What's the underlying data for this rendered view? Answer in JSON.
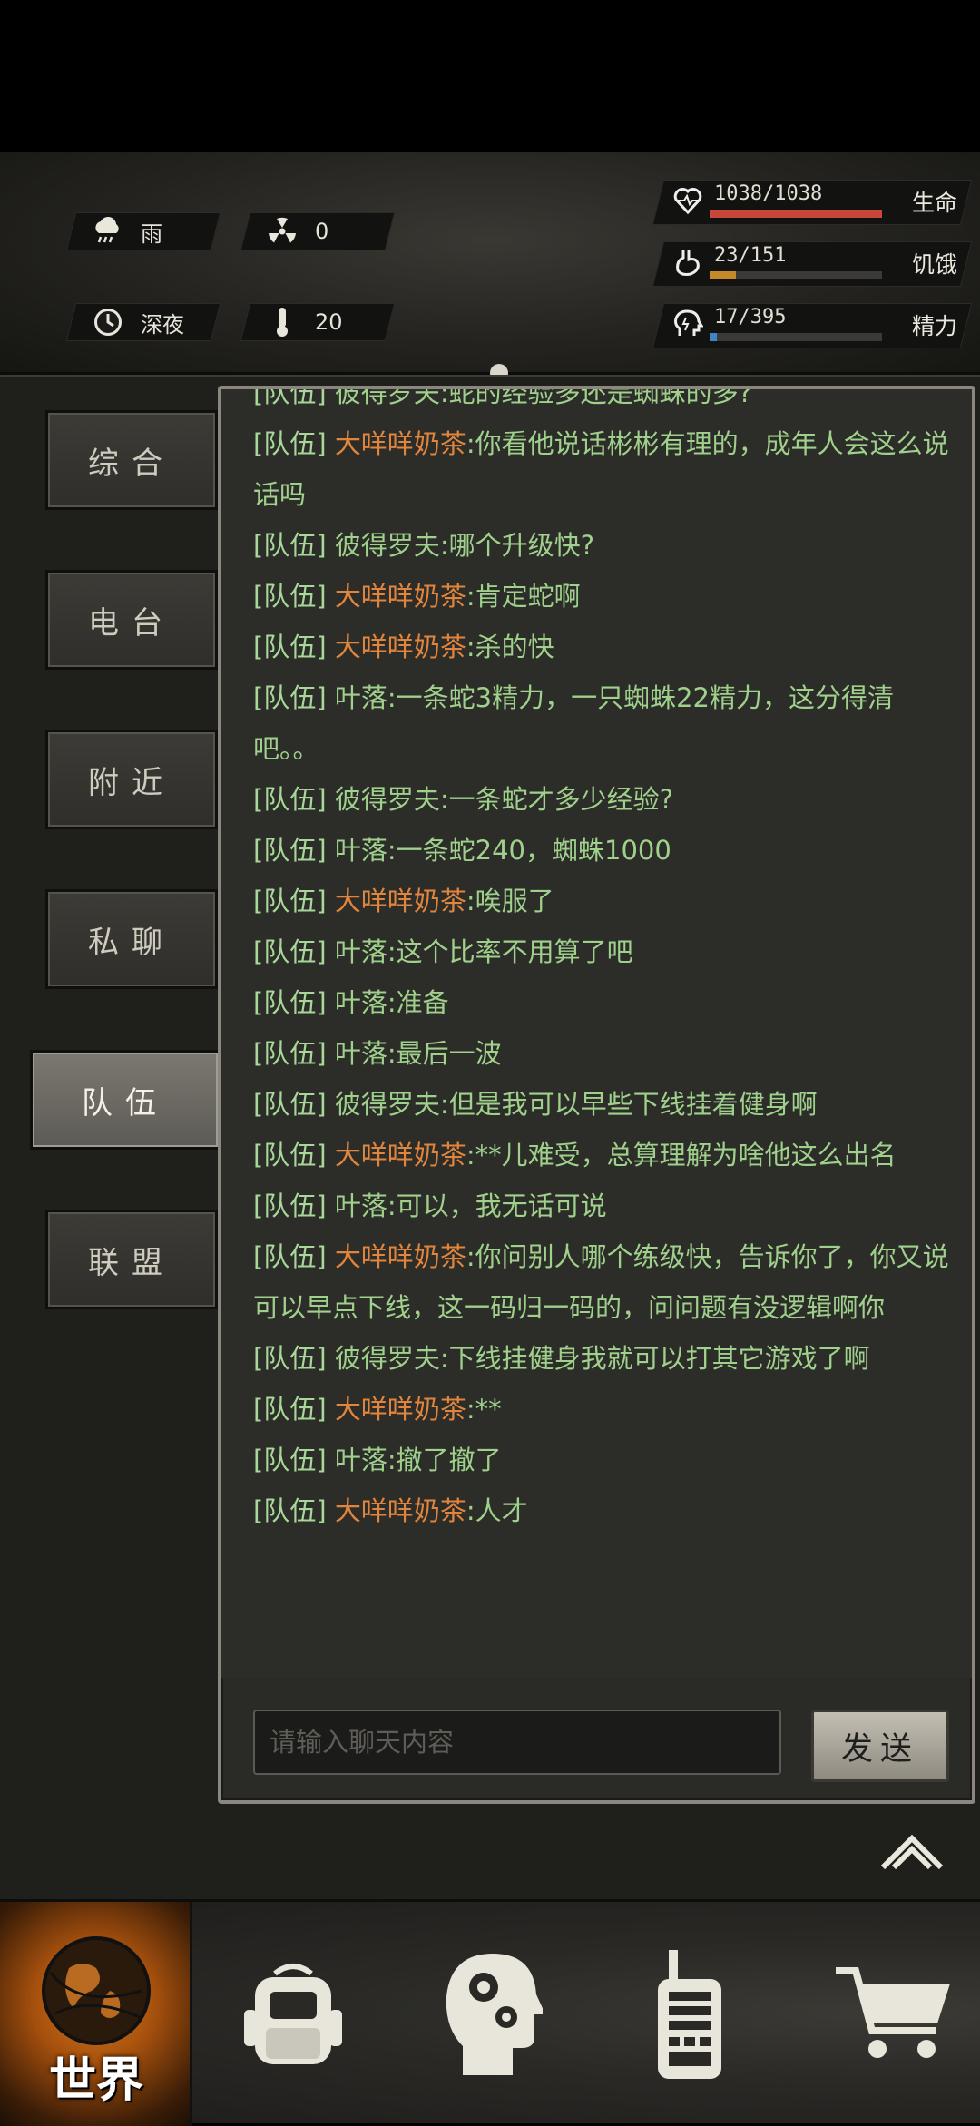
{
  "status": {
    "weather": {
      "icon": "rain-cloud-icon",
      "label": "雨"
    },
    "radiation": {
      "icon": "radiation-icon",
      "value": "0"
    },
    "time": {
      "icon": "clock-icon",
      "label": "深夜"
    },
    "temperature": {
      "icon": "thermometer-icon",
      "value": "20"
    },
    "vitals": [
      {
        "label": "生命",
        "text": "1038/1038",
        "fraction": 1.0,
        "color": "#c8463a",
        "icon": "heart-icon"
      },
      {
        "label": "饥饿",
        "text": "23/151",
        "fraction": 0.152,
        "color": "#c48a2a",
        "icon": "stomach-icon"
      },
      {
        "label": "精力",
        "text": "17/395",
        "fraction": 0.043,
        "color": "#3f86c8",
        "icon": "brain-icon"
      }
    ]
  },
  "tabs": [
    "综合",
    "电台",
    "附近",
    "私聊",
    "队伍",
    "联盟"
  ],
  "active_tab": "队伍",
  "chat": {
    "messages": [
      {
        "channel": "[队伍]",
        "name": "彼得罗夫",
        "orange": false,
        "text": "蛇的经验多还是蜘蛛的多?"
      },
      {
        "channel": "[队伍]",
        "name": "大咩咩奶茶",
        "orange": true,
        "text": "你看他说话彬彬有理的，成年人会这么说话吗"
      },
      {
        "channel": "[队伍]",
        "name": "彼得罗夫",
        "orange": false,
        "text": "哪个升级快?"
      },
      {
        "channel": "[队伍]",
        "name": "大咩咩奶茶",
        "orange": true,
        "text": "肯定蛇啊"
      },
      {
        "channel": "[队伍]",
        "name": "大咩咩奶茶",
        "orange": true,
        "text": "杀的快"
      },
      {
        "channel": "[队伍]",
        "name": "叶落",
        "orange": false,
        "text": "一条蛇3精力，一只蜘蛛22精力，这分得清吧。。"
      },
      {
        "channel": "[队伍]",
        "name": "彼得罗夫",
        "orange": false,
        "text": "一条蛇才多少经验?"
      },
      {
        "channel": "[队伍]",
        "name": "叶落",
        "orange": false,
        "text": "一条蛇240，蜘蛛1000"
      },
      {
        "channel": "[队伍]",
        "name": "大咩咩奶茶",
        "orange": true,
        "text": "唉服了"
      },
      {
        "channel": "[队伍]",
        "name": "叶落",
        "orange": false,
        "text": "这个比率不用算了吧"
      },
      {
        "channel": "[队伍]",
        "name": "叶落",
        "orange": false,
        "text": "准备"
      },
      {
        "channel": "[队伍]",
        "name": "叶落",
        "orange": false,
        "text": "最后一波"
      },
      {
        "channel": "[队伍]",
        "name": "彼得罗夫",
        "orange": false,
        "text": "但是我可以早些下线挂着健身啊"
      },
      {
        "channel": "[队伍]",
        "name": "大咩咩奶茶",
        "orange": true,
        "text": "**儿难受，总算理解为啥他这么出名"
      },
      {
        "channel": "[队伍]",
        "name": "叶落",
        "orange": false,
        "text": "可以，我无话可说"
      },
      {
        "channel": "[队伍]",
        "name": "大咩咩奶茶",
        "orange": true,
        "text": "你问别人哪个练级快，告诉你了，你又说可以早点下线，这一码归一码的，问问题有没逻辑啊你"
      },
      {
        "channel": "[队伍]",
        "name": "彼得罗夫",
        "orange": false,
        "text": "下线挂健身我就可以打其它游戏了啊"
      },
      {
        "channel": "[队伍]",
        "name": "大咩咩奶茶",
        "orange": true,
        "text": "**"
      },
      {
        "channel": "[队伍]",
        "name": "叶落",
        "orange": false,
        "text": "撤了撤了"
      },
      {
        "channel": "[队伍]",
        "name": "大咩咩奶茶",
        "orange": true,
        "text": "人才"
      }
    ],
    "input_placeholder": "请输入聊天内容",
    "send_label": "发送"
  },
  "nav": {
    "world_label": "世界",
    "items": [
      "backpack-icon",
      "head-gears-icon",
      "walkie-talkie-icon",
      "shopping-cart-icon"
    ]
  }
}
